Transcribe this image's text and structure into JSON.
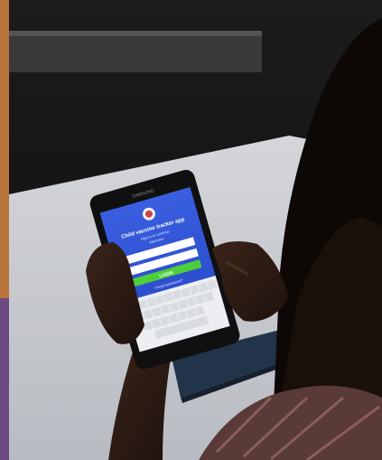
{
  "photo": {
    "subject": "Person holding a Samsung tablet showing a login screen",
    "device": {
      "brand": "SAMSUNG",
      "screen": {
        "app_title": "Child vaccine tracker app",
        "subtitle_line1": "Sign in to continue",
        "subtitle_line2": "Welcome",
        "login_button_label": "LOGIN",
        "footer_text": "Forgot password?"
      }
    },
    "colors": {
      "screen_blue": "#2f54d6",
      "login_green": "#4ccf3a",
      "table": "#c9ccd2",
      "wall": "#1a1a1a"
    }
  }
}
